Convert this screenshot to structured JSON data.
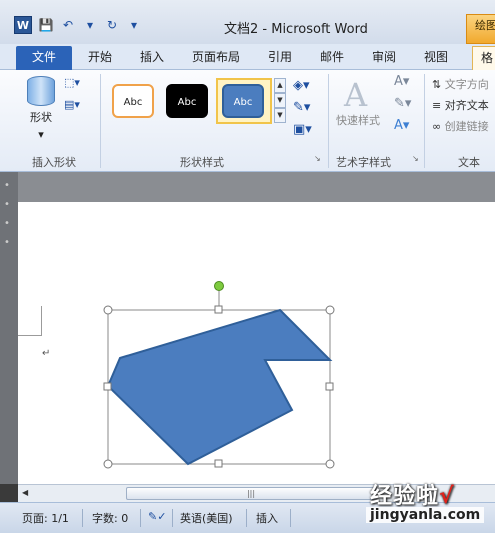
{
  "window": {
    "doc_title": "文档2 - Microsoft Word",
    "context_tab_label": "绘图",
    "app_icon_letter": "W"
  },
  "tabs": {
    "file": "文件",
    "home": "开始",
    "insert": "插入",
    "page_layout": "页面布局",
    "references": "引用",
    "mailings": "邮件",
    "review": "审阅",
    "view": "视图",
    "format": "格"
  },
  "ribbon": {
    "insert_shapes": {
      "shapes_label": "形状",
      "group_label": "插入形状"
    },
    "shape_styles": {
      "style1": "Abc",
      "style2": "Abc",
      "style3": "Abc",
      "group_label": "形状样式"
    },
    "wordart": {
      "quick_styles": "快速样式",
      "group_label": "艺术字样式"
    },
    "text": {
      "direction": "文字方向",
      "align": "对齐文本",
      "link": "创建链接",
      "group_label": "文本"
    }
  },
  "statusbar": {
    "page": "页面: 1/1",
    "words": "字数: 0",
    "language": "英语(美国)",
    "mode": "插入"
  },
  "watermark": {
    "text": "经验啦",
    "check": "√",
    "url": "jingyanla.com"
  },
  "colors": {
    "shape_fill": "#4b7dbf",
    "shape_stroke": "#2f5f99",
    "file_tab": "#2b63b8",
    "handle_rotate": "#7ecb3f"
  }
}
